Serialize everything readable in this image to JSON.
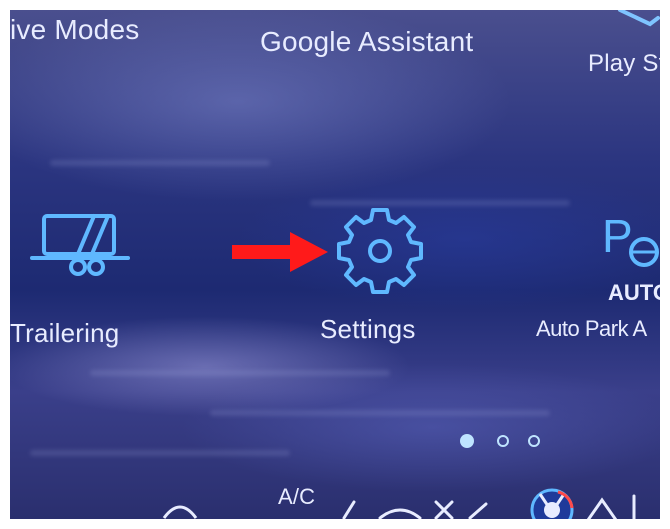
{
  "top_row": {
    "drive_modes_label": "ive Modes",
    "google_assistant_label": "Google Assistant",
    "play_store_label": "Play St"
  },
  "apps": {
    "trailering_label": "Trailering",
    "settings_label": "Settings",
    "auto_park_label": "Auto Park A",
    "auto_park_icon_text": "AUTO",
    "auto_park_icon_letter": "P"
  },
  "bottom_bar": {
    "ac_label": "A/C"
  },
  "pager": {
    "page_count": 3,
    "active_page": 1
  },
  "colors": {
    "icon_color": "#5fb8ff",
    "annotation_arrow": "#ff1a1a",
    "text_color": "#e8ecff"
  },
  "icons": {
    "trailering": "trailer-icon",
    "settings": "gear-icon",
    "auto_park": "auto-park-icon",
    "annotation": "red-arrow-icon"
  }
}
